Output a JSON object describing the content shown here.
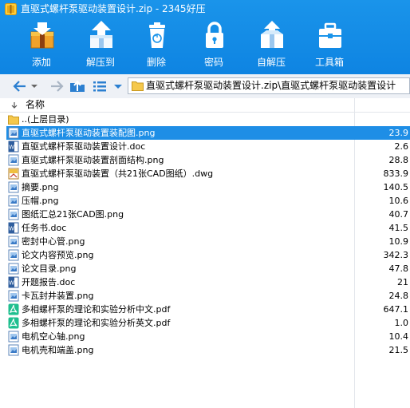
{
  "window": {
    "title": "直驱式螺杆泵驱动装置设计.zip - 2345好压"
  },
  "toolbar": [
    {
      "label": "添加",
      "icon": "add-archive-icon"
    },
    {
      "label": "解压到",
      "icon": "extract-to-icon"
    },
    {
      "label": "删除",
      "icon": "delete-icon"
    },
    {
      "label": "密码",
      "icon": "password-lock-icon"
    },
    {
      "label": "自解压",
      "icon": "self-extract-icon"
    },
    {
      "label": "工具箱",
      "icon": "toolbox-icon"
    }
  ],
  "nav": {
    "path": "直驱式螺杆泵驱动装置设计.zip\\直驱式螺杆泵驱动装置设计"
  },
  "list": {
    "header_name": "名称",
    "parent": "..(上层目录)",
    "files": [
      {
        "name": "直驱式螺杆泵驱动装置装配图.png",
        "size": "23.9",
        "type": "png",
        "selected": true
      },
      {
        "name": "直驱式螺杆泵驱动装置设计.doc",
        "size": "2.6",
        "type": "doc"
      },
      {
        "name": "直驱式螺杆泵驱动装置剖面结构.png",
        "size": "28.8",
        "type": "png"
      },
      {
        "name": "直驱式螺杆泵驱动装置（共21张CAD图纸）.dwg",
        "size": "833.9",
        "type": "dwg"
      },
      {
        "name": "摘要.png",
        "size": "140.5",
        "type": "png"
      },
      {
        "name": "压帽.png",
        "size": "10.6",
        "type": "png"
      },
      {
        "name": "图纸汇总21张CAD图.png",
        "size": "40.7",
        "type": "png"
      },
      {
        "name": "任务书.doc",
        "size": "41.5",
        "type": "doc"
      },
      {
        "name": "密封中心管.png",
        "size": "10.9",
        "type": "png"
      },
      {
        "name": "论文内容预览.png",
        "size": "342.3",
        "type": "png"
      },
      {
        "name": "论文目录.png",
        "size": "47.8",
        "type": "png"
      },
      {
        "name": "开题报告.doc",
        "size": "21",
        "type": "doc"
      },
      {
        "name": "卡瓦封井装置.png",
        "size": "24.8",
        "type": "png"
      },
      {
        "name": "多相螺杆泵的理论和实验分析中文.pdf",
        "size": "647.1",
        "type": "pdf"
      },
      {
        "name": "多相螺杆泵的理论和实验分析英文.pdf",
        "size": "1.0",
        "type": "pdf"
      },
      {
        "name": "电机空心轴.png",
        "size": "10.4",
        "type": "png"
      },
      {
        "name": "电机壳和端盖.png",
        "size": "21.5",
        "type": "png"
      }
    ]
  },
  "colors": {
    "toolbar_bg": "#1a94ea",
    "selection": "#1e8ee6",
    "nav_bg": "#eef1f6"
  }
}
